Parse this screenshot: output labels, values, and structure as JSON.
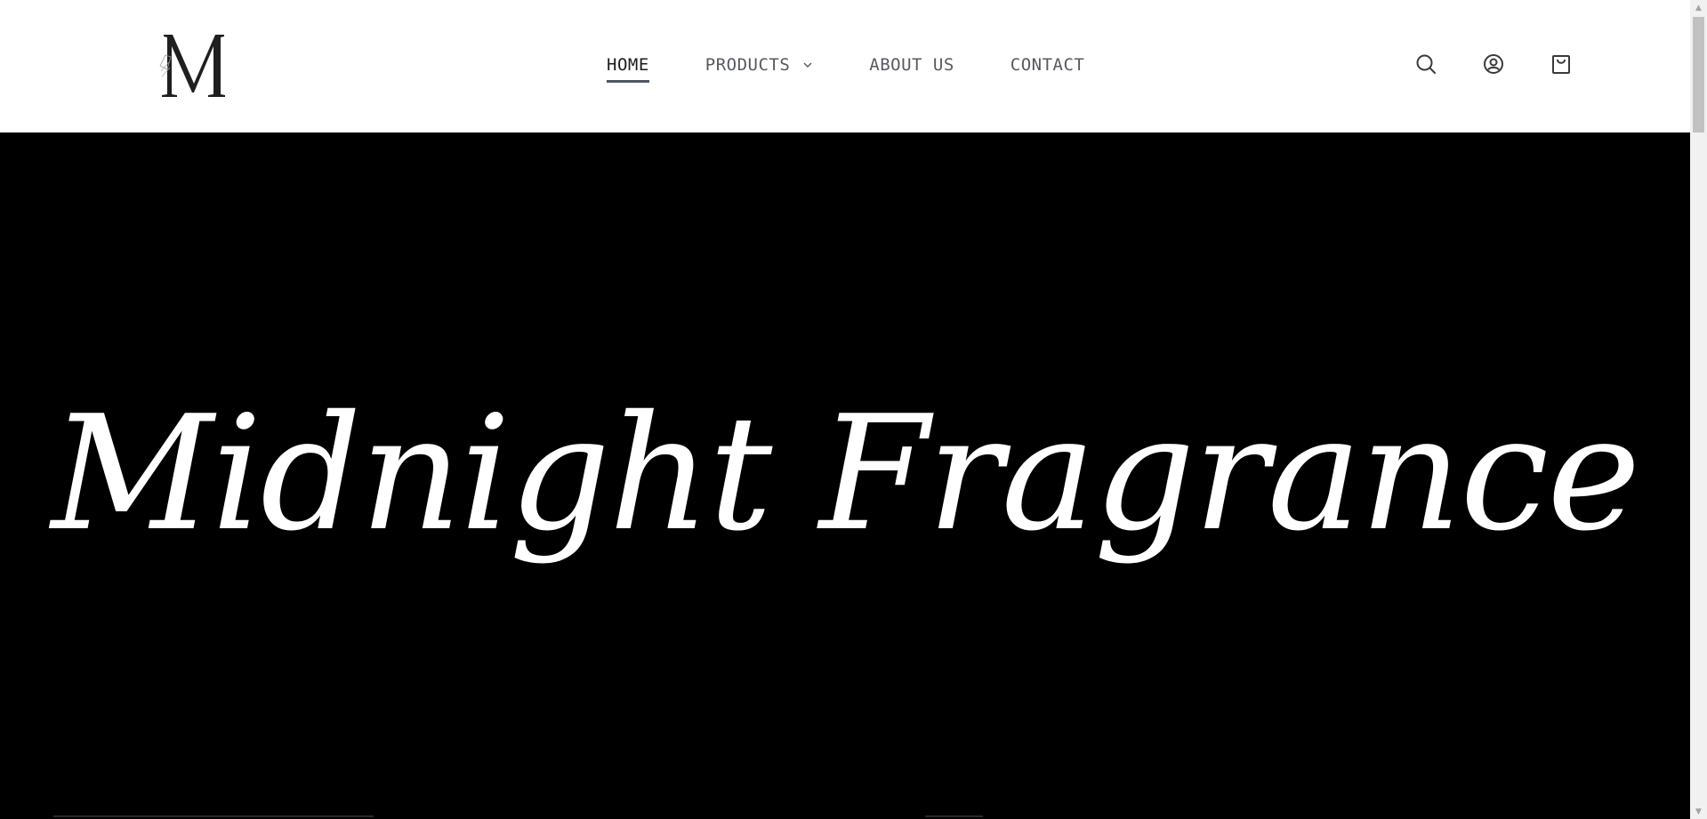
{
  "header": {
    "logo_letter": "M",
    "nav": [
      {
        "label": "HOME",
        "active": true
      },
      {
        "label": "PRODUCTS",
        "has_dropdown": true
      },
      {
        "label": "ABOUT US"
      },
      {
        "label": "CONTACT"
      }
    ],
    "icons": [
      "search-icon",
      "account-icon",
      "cart-icon"
    ]
  },
  "hero": {
    "title": "Midnight Fragrance",
    "background": "#000000",
    "text_color": "#ffffff"
  },
  "colors": {
    "nav_text": "#555a60",
    "nav_active": "#1c1c1c",
    "active_underline": "#4d5663"
  }
}
